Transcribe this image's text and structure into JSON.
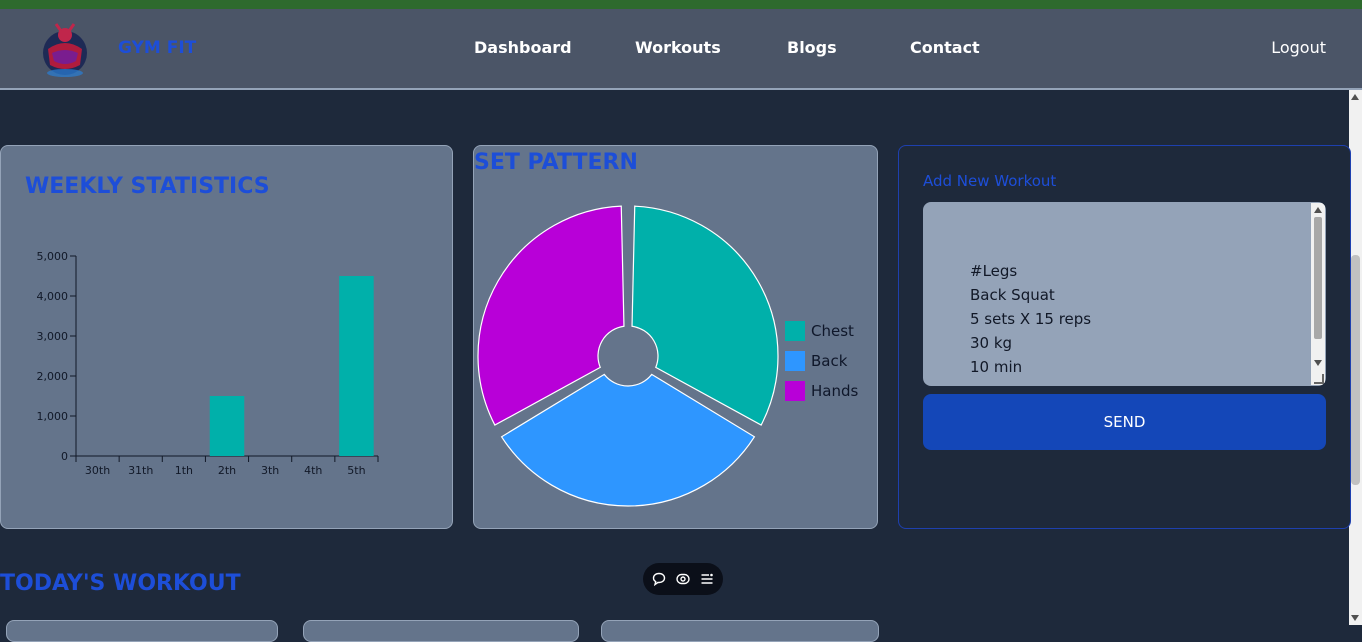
{
  "navbar": {
    "brand": "GYM FIT",
    "links": [
      "Dashboard",
      "Workouts",
      "Blogs",
      "Contact"
    ],
    "logout": "Logout"
  },
  "weekly": {
    "title": "WEEKLY STATISTICS"
  },
  "pattern": {
    "title": "SET PATTERN"
  },
  "chart_data": [
    {
      "type": "bar",
      "title": "WEEKLY STATISTICS",
      "categories": [
        "30th",
        "31th",
        "1th",
        "2th",
        "3th",
        "4th",
        "5th"
      ],
      "values": [
        0,
        0,
        0,
        1500,
        0,
        0,
        4500
      ],
      "ylim": [
        0,
        5000
      ],
      "yticks": [
        0,
        1000,
        2000,
        3000,
        4000,
        5000
      ],
      "ytick_labels": [
        "0",
        "1,000",
        "2,000",
        "3,000",
        "4,000",
        "5,000"
      ],
      "bar_color": "#00b0aa",
      "grid": false
    },
    {
      "type": "pie",
      "title": "SET PATTERN",
      "labels": [
        "Chest",
        "Back",
        "Hands"
      ],
      "values": [
        1,
        1,
        1
      ],
      "colors": [
        "#00b0aa",
        "#2e96ff",
        "#b800d8"
      ],
      "legend": "right"
    }
  ],
  "add_workout": {
    "title": "Add New Workout",
    "lines": [
      "#Legs",
      "Back Squat",
      "5 sets X 15 reps",
      "30 kg",
      "10 min"
    ],
    "send_label": "SEND"
  },
  "today": {
    "title": "TODAY'S WORKOUT"
  },
  "toolbar": {
    "icons": [
      "comment-icon",
      "eye-icon",
      "menu-icon"
    ]
  },
  "colors": {
    "accent": "#1d4ed8",
    "background": "#1e293b",
    "card": "#64748b",
    "button": "#1447b8"
  }
}
